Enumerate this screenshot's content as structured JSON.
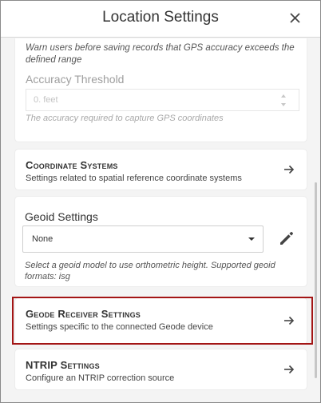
{
  "header": {
    "title": "Location Settings"
  },
  "accuracy": {
    "warn_text": "Warn users before saving records that GPS accuracy exceeds the defined range",
    "threshold_label": "Accuracy Threshold",
    "threshold_value": "0. feet",
    "threshold_help": "The accuracy required to capture GPS coordinates"
  },
  "coordinate_systems": {
    "title": "Coordinate Systems",
    "subtitle": "Settings related to spatial reference coordinate systems"
  },
  "geoid": {
    "label": "Geoid Settings",
    "selected": "None",
    "help": "Select a geoid model to use orthometric height. Supported geoid formats: isg"
  },
  "geode_receiver": {
    "title": "Geode Receiver Settings",
    "subtitle": "Settings specific to the connected Geode device"
  },
  "ntrip": {
    "title": "NTRIP Settings",
    "subtitle": "Configure an NTRIP correction source"
  },
  "colors": {
    "highlight": "#a31515",
    "background": "#f4f4f4",
    "card": "#ffffff",
    "text": "#333333"
  },
  "icons": {
    "close": "close-icon",
    "arrow": "arrow-right-icon",
    "edit": "pencil-icon",
    "dropdown": "chevron-down-icon"
  }
}
